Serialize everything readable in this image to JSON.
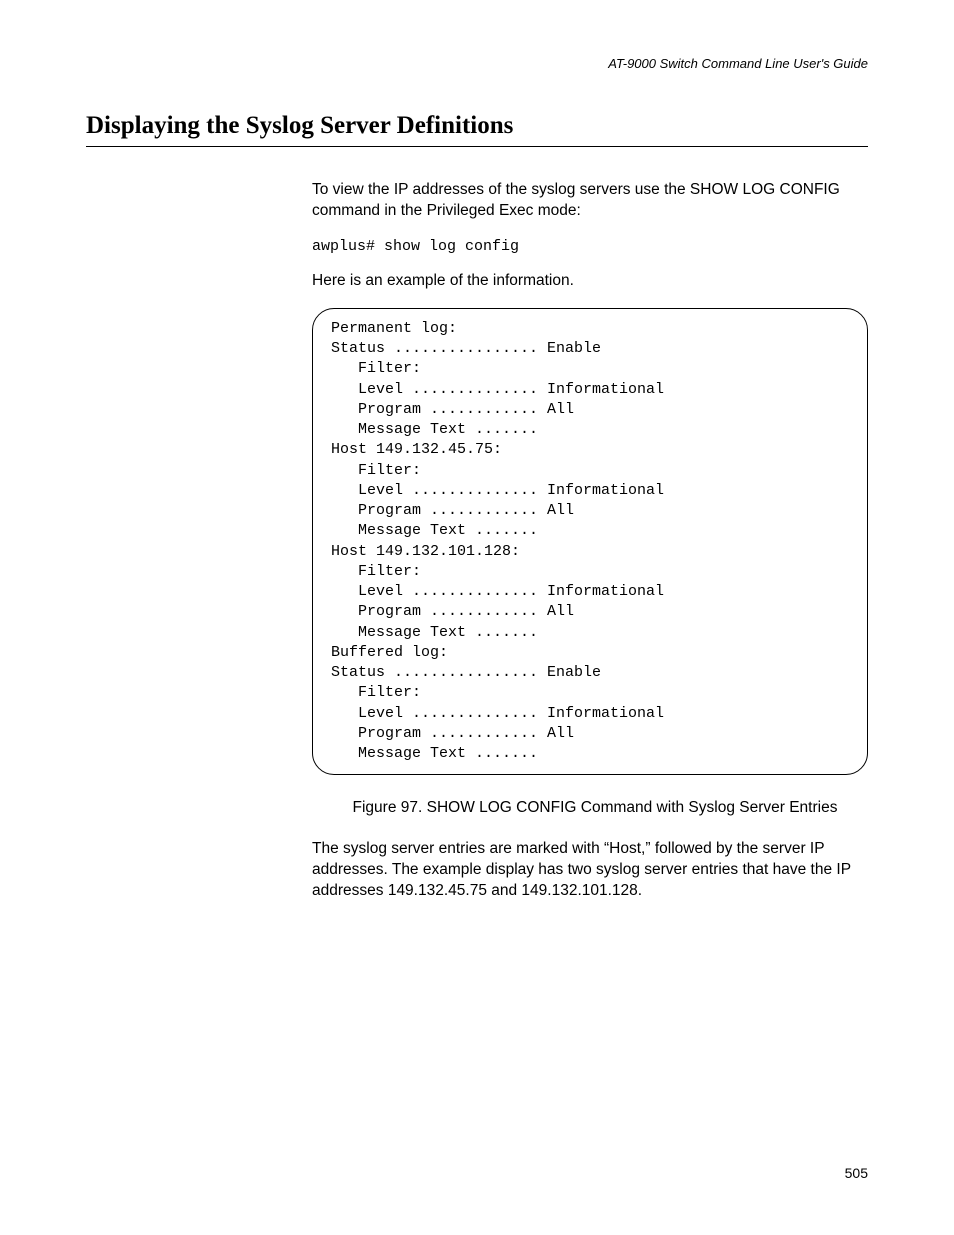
{
  "header": "AT-9000 Switch Command Line User's Guide",
  "heading": "Displaying the Syslog Server Definitions",
  "intro_para": "To view the IP addresses of the syslog servers use the SHOW LOG CONFIG command in the Privileged Exec mode:",
  "command": "awplus# show log config",
  "example_lead": "Here is an example of the information.",
  "output": "Permanent log:\nStatus ................ Enable\n   Filter:\n   Level .............. Informational\n   Program ............ All\n   Message Text .......\nHost 149.132.45.75:\n   Filter:\n   Level .............. Informational\n   Program ............ All\n   Message Text .......\nHost 149.132.101.128:\n   Filter:\n   Level .............. Informational\n   Program ............ All\n   Message Text .......\nBuffered log:\nStatus ................ Enable\n   Filter:\n   Level .............. Informational\n   Program ............ All\n   Message Text .......",
  "figure_caption": "Figure 97. SHOW LOG CONFIG Command with Syslog Server Entries",
  "closing_para": "The syslog server entries are marked with “Host,” followed by the server IP addresses. The example display has two syslog server entries that have the IP addresses 149.132.45.75 and 149.132.101.128.",
  "page_number": "505"
}
